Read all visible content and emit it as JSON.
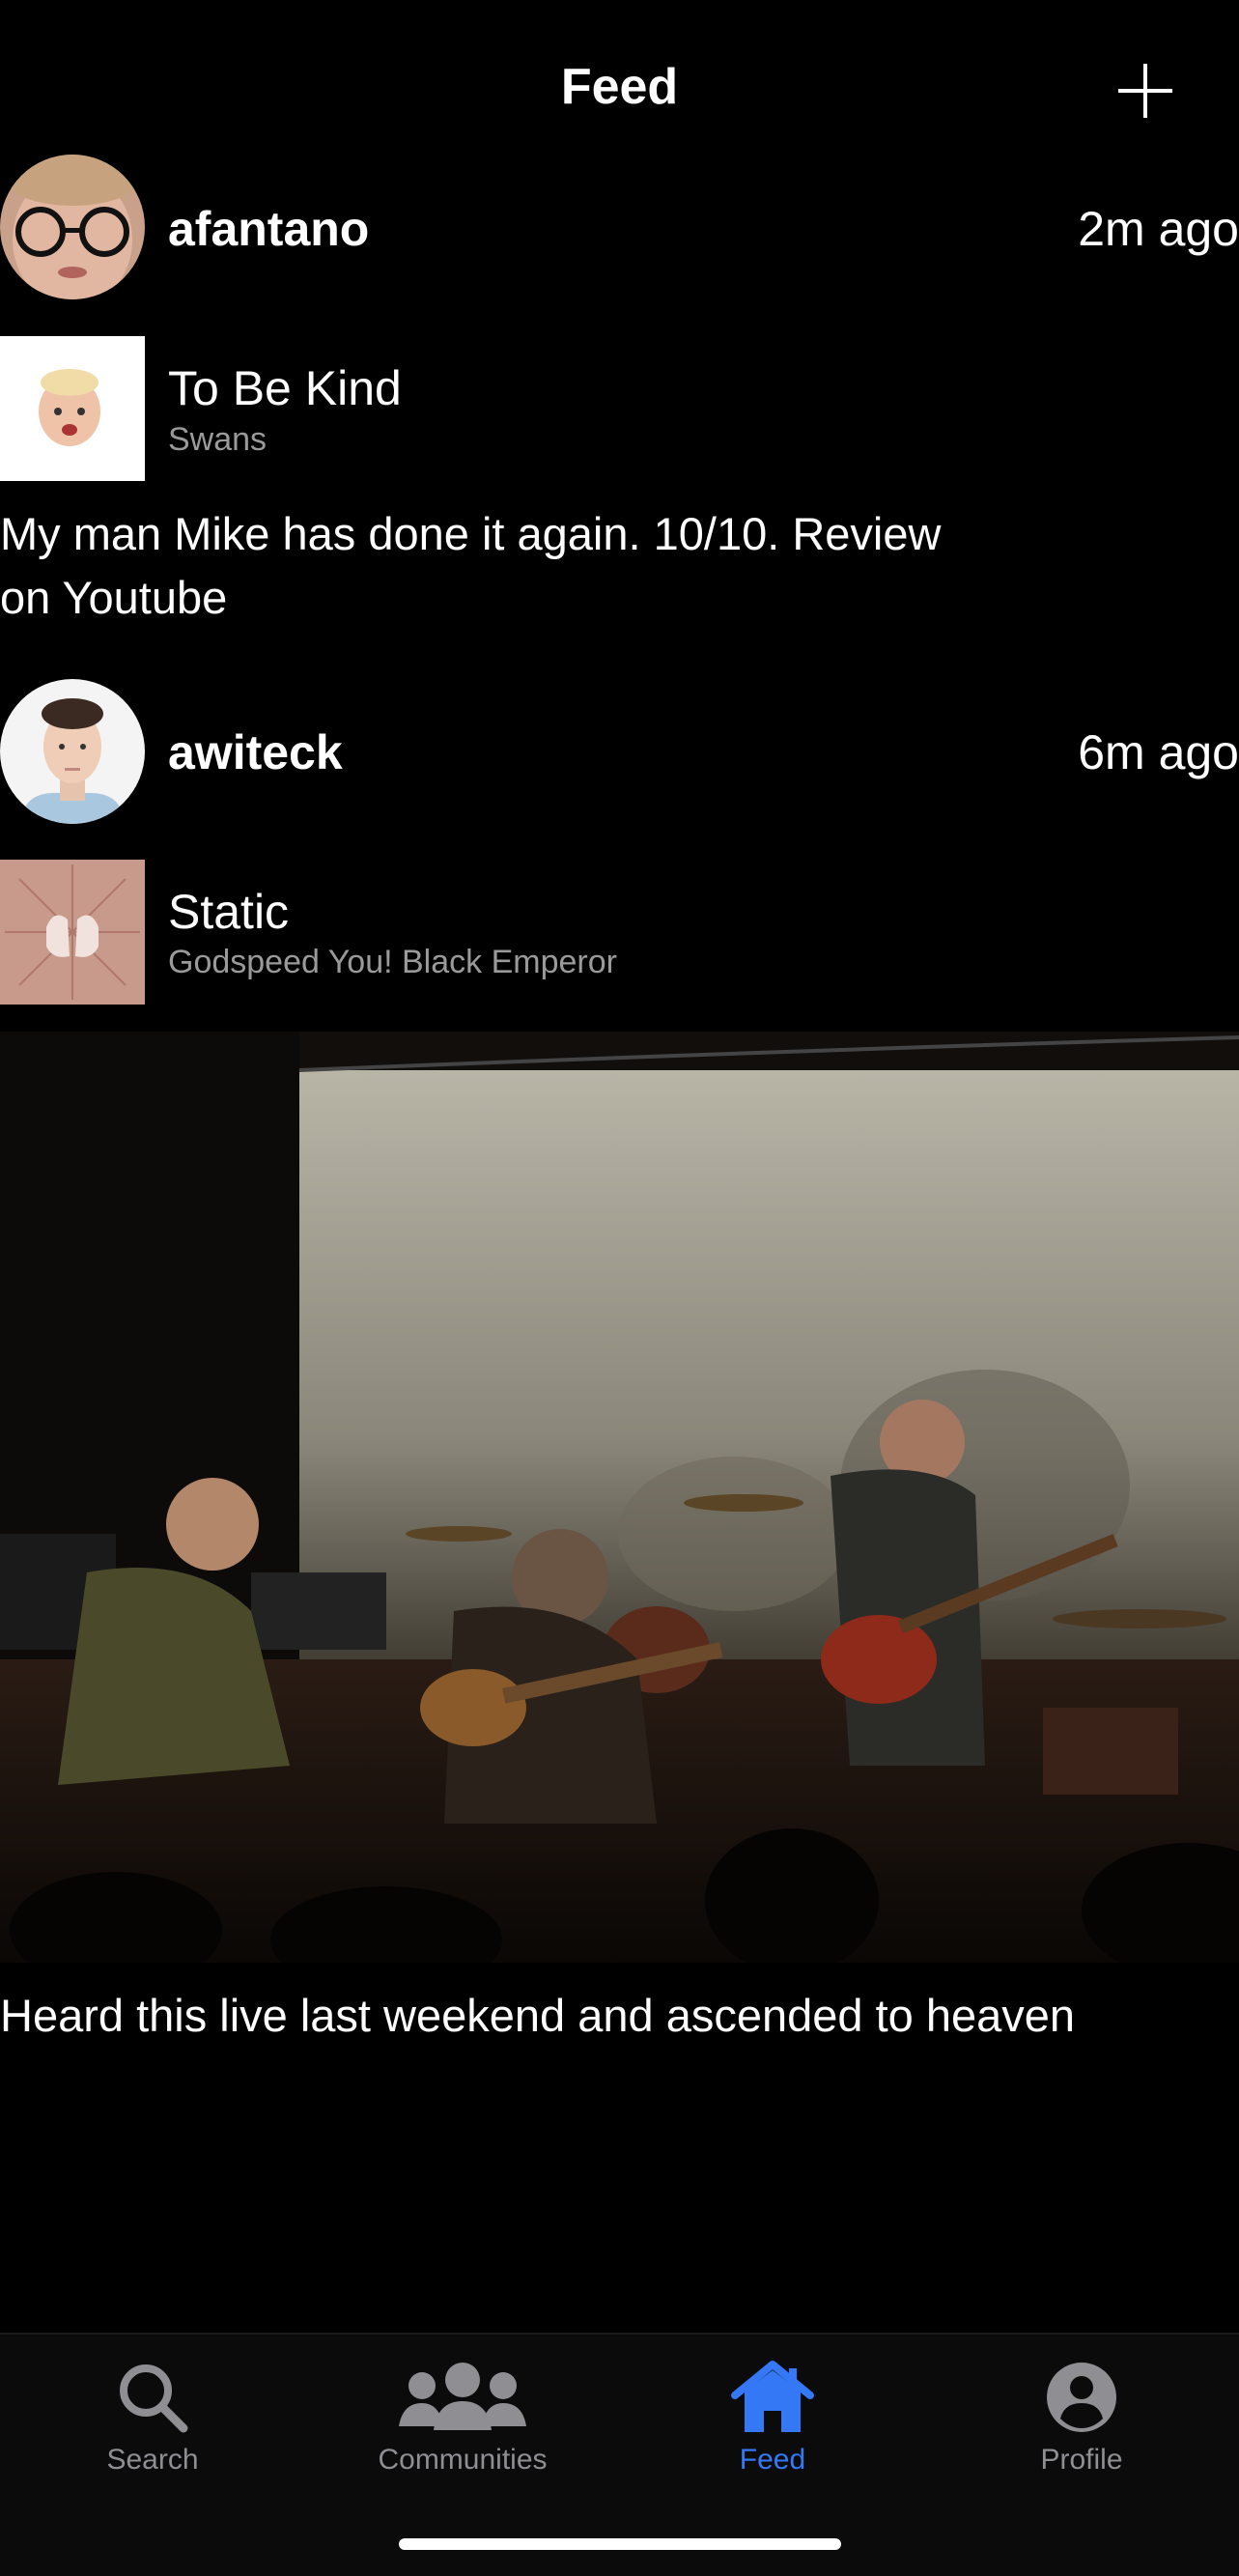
{
  "header": {
    "title": "Feed"
  },
  "posts": [
    {
      "username": "afantano",
      "time": "2m ago",
      "track": "To Be Kind",
      "artist": "Swans",
      "text_line1": "My man Mike has done it again. 10/10. Review",
      "text_line2": "on Youtube"
    },
    {
      "username": "awiteck",
      "time": "6m ago",
      "track": "Static",
      "artist": "Godspeed You! Black Emperor",
      "text": "Heard this live last weekend and ascended to heaven"
    }
  ],
  "tabs": [
    {
      "label": "Search",
      "icon": "search-icon"
    },
    {
      "label": "Communities",
      "icon": "people-icon"
    },
    {
      "label": "Feed",
      "icon": "home-icon"
    },
    {
      "label": "Profile",
      "icon": "person-icon"
    }
  ],
  "colors": {
    "accent": "#3478f6",
    "inactive": "#8e8e93",
    "background": "#000000"
  }
}
